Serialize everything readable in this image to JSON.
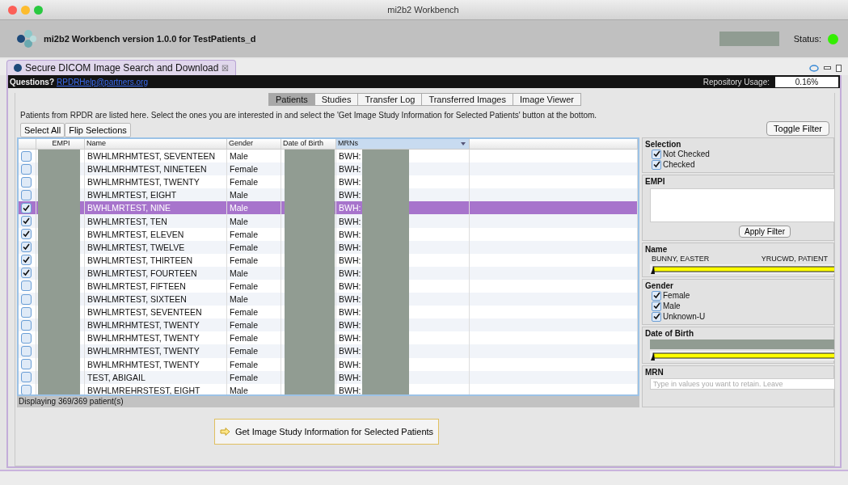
{
  "window": {
    "title": "mi2b2 Workbench"
  },
  "header": {
    "title": "mi2b2 Workbench version 1.0.0 for TestPatients_d",
    "status_label": "Status:"
  },
  "view": {
    "title": "Secure DICOM Image Search and Download",
    "close_glyph": "☒"
  },
  "info_bar": {
    "question": "Questions?",
    "email": "RPDRHelp@partners.org",
    "usage_label": "Repository Usage:",
    "usage_value": "0.16%"
  },
  "tabs": [
    {
      "label": "Patients",
      "selected": true
    },
    {
      "label": "Studies",
      "selected": false
    },
    {
      "label": "Transfer Log",
      "selected": false
    },
    {
      "label": "Transferred Images",
      "selected": false
    },
    {
      "label": "Image Viewer",
      "selected": false
    }
  ],
  "instructions": "Patients from RPDR are listed here. Select the ones you are interested in and select the 'Get Image Study Information for Selected Patients' button at the bottom.",
  "buttons": {
    "select_all": "Select All",
    "flip": "Flip Selections",
    "toggle_filter": "Toggle Filter"
  },
  "table": {
    "columns": [
      "EMPI",
      "Name",
      "Gender",
      "Date of Birth",
      "MRNs"
    ],
    "rows": [
      {
        "checked": false,
        "selected": false,
        "name": "BWHLMRHMTEST, SEVENTEEN",
        "gender": "Male",
        "mrn": "BWH:"
      },
      {
        "checked": false,
        "selected": false,
        "name": "BWHLMRHMTEST, NINETEEN",
        "gender": "Female",
        "mrn": "BWH:"
      },
      {
        "checked": false,
        "selected": false,
        "name": "BWHLMRHMTEST, TWENTY",
        "gender": "Female",
        "mrn": "BWH:"
      },
      {
        "checked": false,
        "selected": false,
        "name": "BWHLMRTEST, EIGHT",
        "gender": "Male",
        "mrn": "BWH:"
      },
      {
        "checked": true,
        "selected": true,
        "name": "BWHLMRTEST, NINE",
        "gender": "Male",
        "mrn": "BWH:"
      },
      {
        "checked": true,
        "selected": false,
        "name": "BWHLMRTEST, TEN",
        "gender": "Male",
        "mrn": "BWH:"
      },
      {
        "checked": true,
        "selected": false,
        "name": "BWHLMRTEST, ELEVEN",
        "gender": "Female",
        "mrn": "BWH:"
      },
      {
        "checked": true,
        "selected": false,
        "name": "BWHLMRTEST, TWELVE",
        "gender": "Female",
        "mrn": "BWH:"
      },
      {
        "checked": true,
        "selected": false,
        "name": "BWHLMRTEST, THIRTEEN",
        "gender": "Female",
        "mrn": "BWH:"
      },
      {
        "checked": true,
        "selected": false,
        "name": "BWHLMRTEST, FOURTEEN",
        "gender": "Male",
        "mrn": "BWH:"
      },
      {
        "checked": false,
        "selected": false,
        "name": "BWHLMRTEST, FIFTEEN",
        "gender": "Female",
        "mrn": "BWH:"
      },
      {
        "checked": false,
        "selected": false,
        "name": "BWHLMRTEST, SIXTEEN",
        "gender": "Male",
        "mrn": "BWH:"
      },
      {
        "checked": false,
        "selected": false,
        "name": "BWHLMRTEST, SEVENTEEN",
        "gender": "Female",
        "mrn": "BWH:"
      },
      {
        "checked": false,
        "selected": false,
        "name": "BWHLMRHMTEST, TWENTY",
        "gender": "Female",
        "mrn": "BWH:"
      },
      {
        "checked": false,
        "selected": false,
        "name": "BWHLMRHMTEST, TWENTY",
        "gender": "Female",
        "mrn": "BWH:"
      },
      {
        "checked": false,
        "selected": false,
        "name": "BWHLMRHMTEST, TWENTY",
        "gender": "Female",
        "mrn": "BWH:"
      },
      {
        "checked": false,
        "selected": false,
        "name": "BWHLMRHMTEST, TWENTY",
        "gender": "Female",
        "mrn": "BWH:"
      },
      {
        "checked": false,
        "selected": false,
        "name": "TEST, ABIGAIL",
        "gender": "Female",
        "mrn": "BWH:"
      },
      {
        "checked": false,
        "selected": false,
        "name": "BWHLMREHRSTEST, EIGHT",
        "gender": "Male",
        "mrn": "BWH:"
      }
    ]
  },
  "table_status": "Displaying 369/369 patient(s)",
  "action_button": "Get Image Study Information for Selected Patients",
  "filter": {
    "selection": {
      "title": "Selection",
      "options": [
        {
          "label": "Not Checked",
          "checked": true
        },
        {
          "label": "Checked",
          "checked": true
        }
      ]
    },
    "empi": {
      "title": "EMPI",
      "button": "Apply Filter"
    },
    "name": {
      "title": "Name",
      "min": "BUNNY, EASTER",
      "max": "YRUCWD, PATIENT",
      "level": 1
    },
    "gender": {
      "title": "Gender",
      "options": [
        {
          "label": "Female",
          "checked": true
        },
        {
          "label": "Male",
          "checked": true
        },
        {
          "label": "Unknown-U",
          "checked": true
        }
      ]
    },
    "dob": {
      "title": "Date of Birth",
      "level": 1
    },
    "mrn": {
      "title": "MRN",
      "placeholder": "Type in values you want to retain. Leave"
    }
  }
}
